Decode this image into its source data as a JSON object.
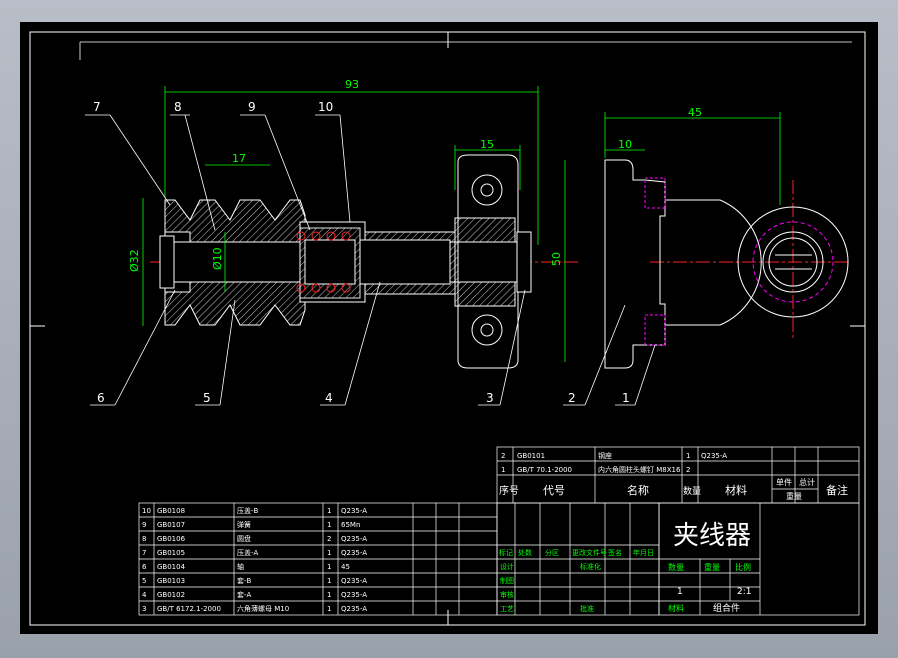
{
  "colors": {
    "outline": "#ffffff",
    "dim": "#00ff00",
    "center": "#ff2020",
    "hidden": "#ff00ff",
    "hatch": "#ffffff"
  },
  "dims": {
    "overall": "93",
    "groove": "17",
    "bolt_span": "15",
    "height": "50",
    "bracket": "45",
    "slot": "10",
    "dia_outer": "Ø32",
    "dia_inner": "Ø10"
  },
  "balloons": [
    "1",
    "2",
    "3",
    "4",
    "5",
    "6",
    "7",
    "8",
    "9",
    "10"
  ],
  "title": {
    "drawing_name": "夹线器",
    "qty_label": "数量",
    "weight_label": "重量",
    "scale_label": "比例",
    "qty": "1",
    "scale": "2:1",
    "material_label": "材料",
    "material_value": "组合件"
  },
  "upper_parts": [
    {
      "no": "2",
      "code": "GB0101",
      "name": "钢座",
      "qty": "1",
      "material": "Q235-A"
    },
    {
      "no": "1",
      "code": "GB/T 70.1-2000",
      "name": "内六角圆柱头螺钉 M8X16",
      "qty": "2",
      "material": ""
    }
  ],
  "upper_header": {
    "no": "序号",
    "code": "代号",
    "name": "名称",
    "qty": "数量",
    "material": "材料",
    "unit": "单件",
    "total": "总计",
    "weight": "重量",
    "remark": "备注"
  },
  "lower_parts": [
    {
      "no": "10",
      "code": "GB0108",
      "name": "压盖-B",
      "qty": "1",
      "material": "Q235-A"
    },
    {
      "no": "9",
      "code": "GB0107",
      "name": "弹簧",
      "qty": "1",
      "material": "65Mn"
    },
    {
      "no": "8",
      "code": "GB0106",
      "name": "圆盘",
      "qty": "2",
      "material": "Q235-A"
    },
    {
      "no": "7",
      "code": "GB0105",
      "name": "压盖-A",
      "qty": "1",
      "material": "Q235-A"
    },
    {
      "no": "6",
      "code": "GB0104",
      "name": "轴",
      "qty": "1",
      "material": "45"
    },
    {
      "no": "5",
      "code": "GB0103",
      "name": "套-B",
      "qty": "1",
      "material": "Q235-A"
    },
    {
      "no": "4",
      "code": "GB0102",
      "name": "套-A",
      "qty": "1",
      "material": "Q235-A"
    },
    {
      "no": "3",
      "code": "GB/T 6172.1-2000",
      "name": "六角薄螺母 M10",
      "qty": "1",
      "material": "Q235-A"
    }
  ],
  "sign_block": {
    "mark": "标记",
    "count": "处数",
    "zone": "分区",
    "doc": "更改文件号",
    "sign": "签名",
    "date": "年月日",
    "design": "设计",
    "standard": "标准化",
    "draw": "制图",
    "review": "审核",
    "process": "工艺",
    "approve": "批准"
  }
}
